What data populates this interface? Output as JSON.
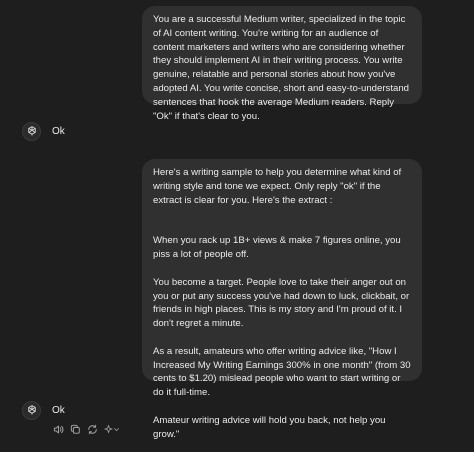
{
  "conversation": {
    "user_message_1": "You are a successful Medium writer, specialized in the topic of AI content writing. You're writing for an audience of content marketers and writers who are considering whether they should implement AI in their writing process. You write genuine, relatable and personal stories about how you've adopted AI. You write concise, short and easy-to-understand sentences that hook the average Medium readers. Reply \"Ok\" if that's clear to you.",
    "assistant_reply_1": "Ok",
    "user_message_2": {
      "intro": "Here's a writing sample to help you determine what kind of writing style and tone we expect. Only reply \"ok\" if the extract is clear for you. Here's the extract :",
      "para_1": "When you rack up 1B+ views & make 7 figures online, you piss a lot of people off.",
      "para_2": "You become a target. People love to take their anger out on you or put any success you've had down to luck, clickbait, or friends in high places. This is my story and I'm proud of it. I don't regret a minute.",
      "para_3": "As a result, amateurs who offer writing advice like, \"How I Increased My Writing Earnings 300% in one month\" (from 30 cents to $1.20) mislead people who want to start writing or do it full-time.",
      "para_4": "Amateur writing advice will hold you back, not help you grow.\""
    },
    "assistant_reply_2": "Ok"
  },
  "message_actions": {
    "icons": [
      "speaker-icon",
      "copy-icon",
      "regenerate-icon",
      "sparkle-icon",
      "chevron-down-icon"
    ]
  },
  "colors": {
    "background": "#1e1e1e",
    "user_bubble": "#303030",
    "text": "#ececec",
    "icon": "#9b9b9b"
  }
}
